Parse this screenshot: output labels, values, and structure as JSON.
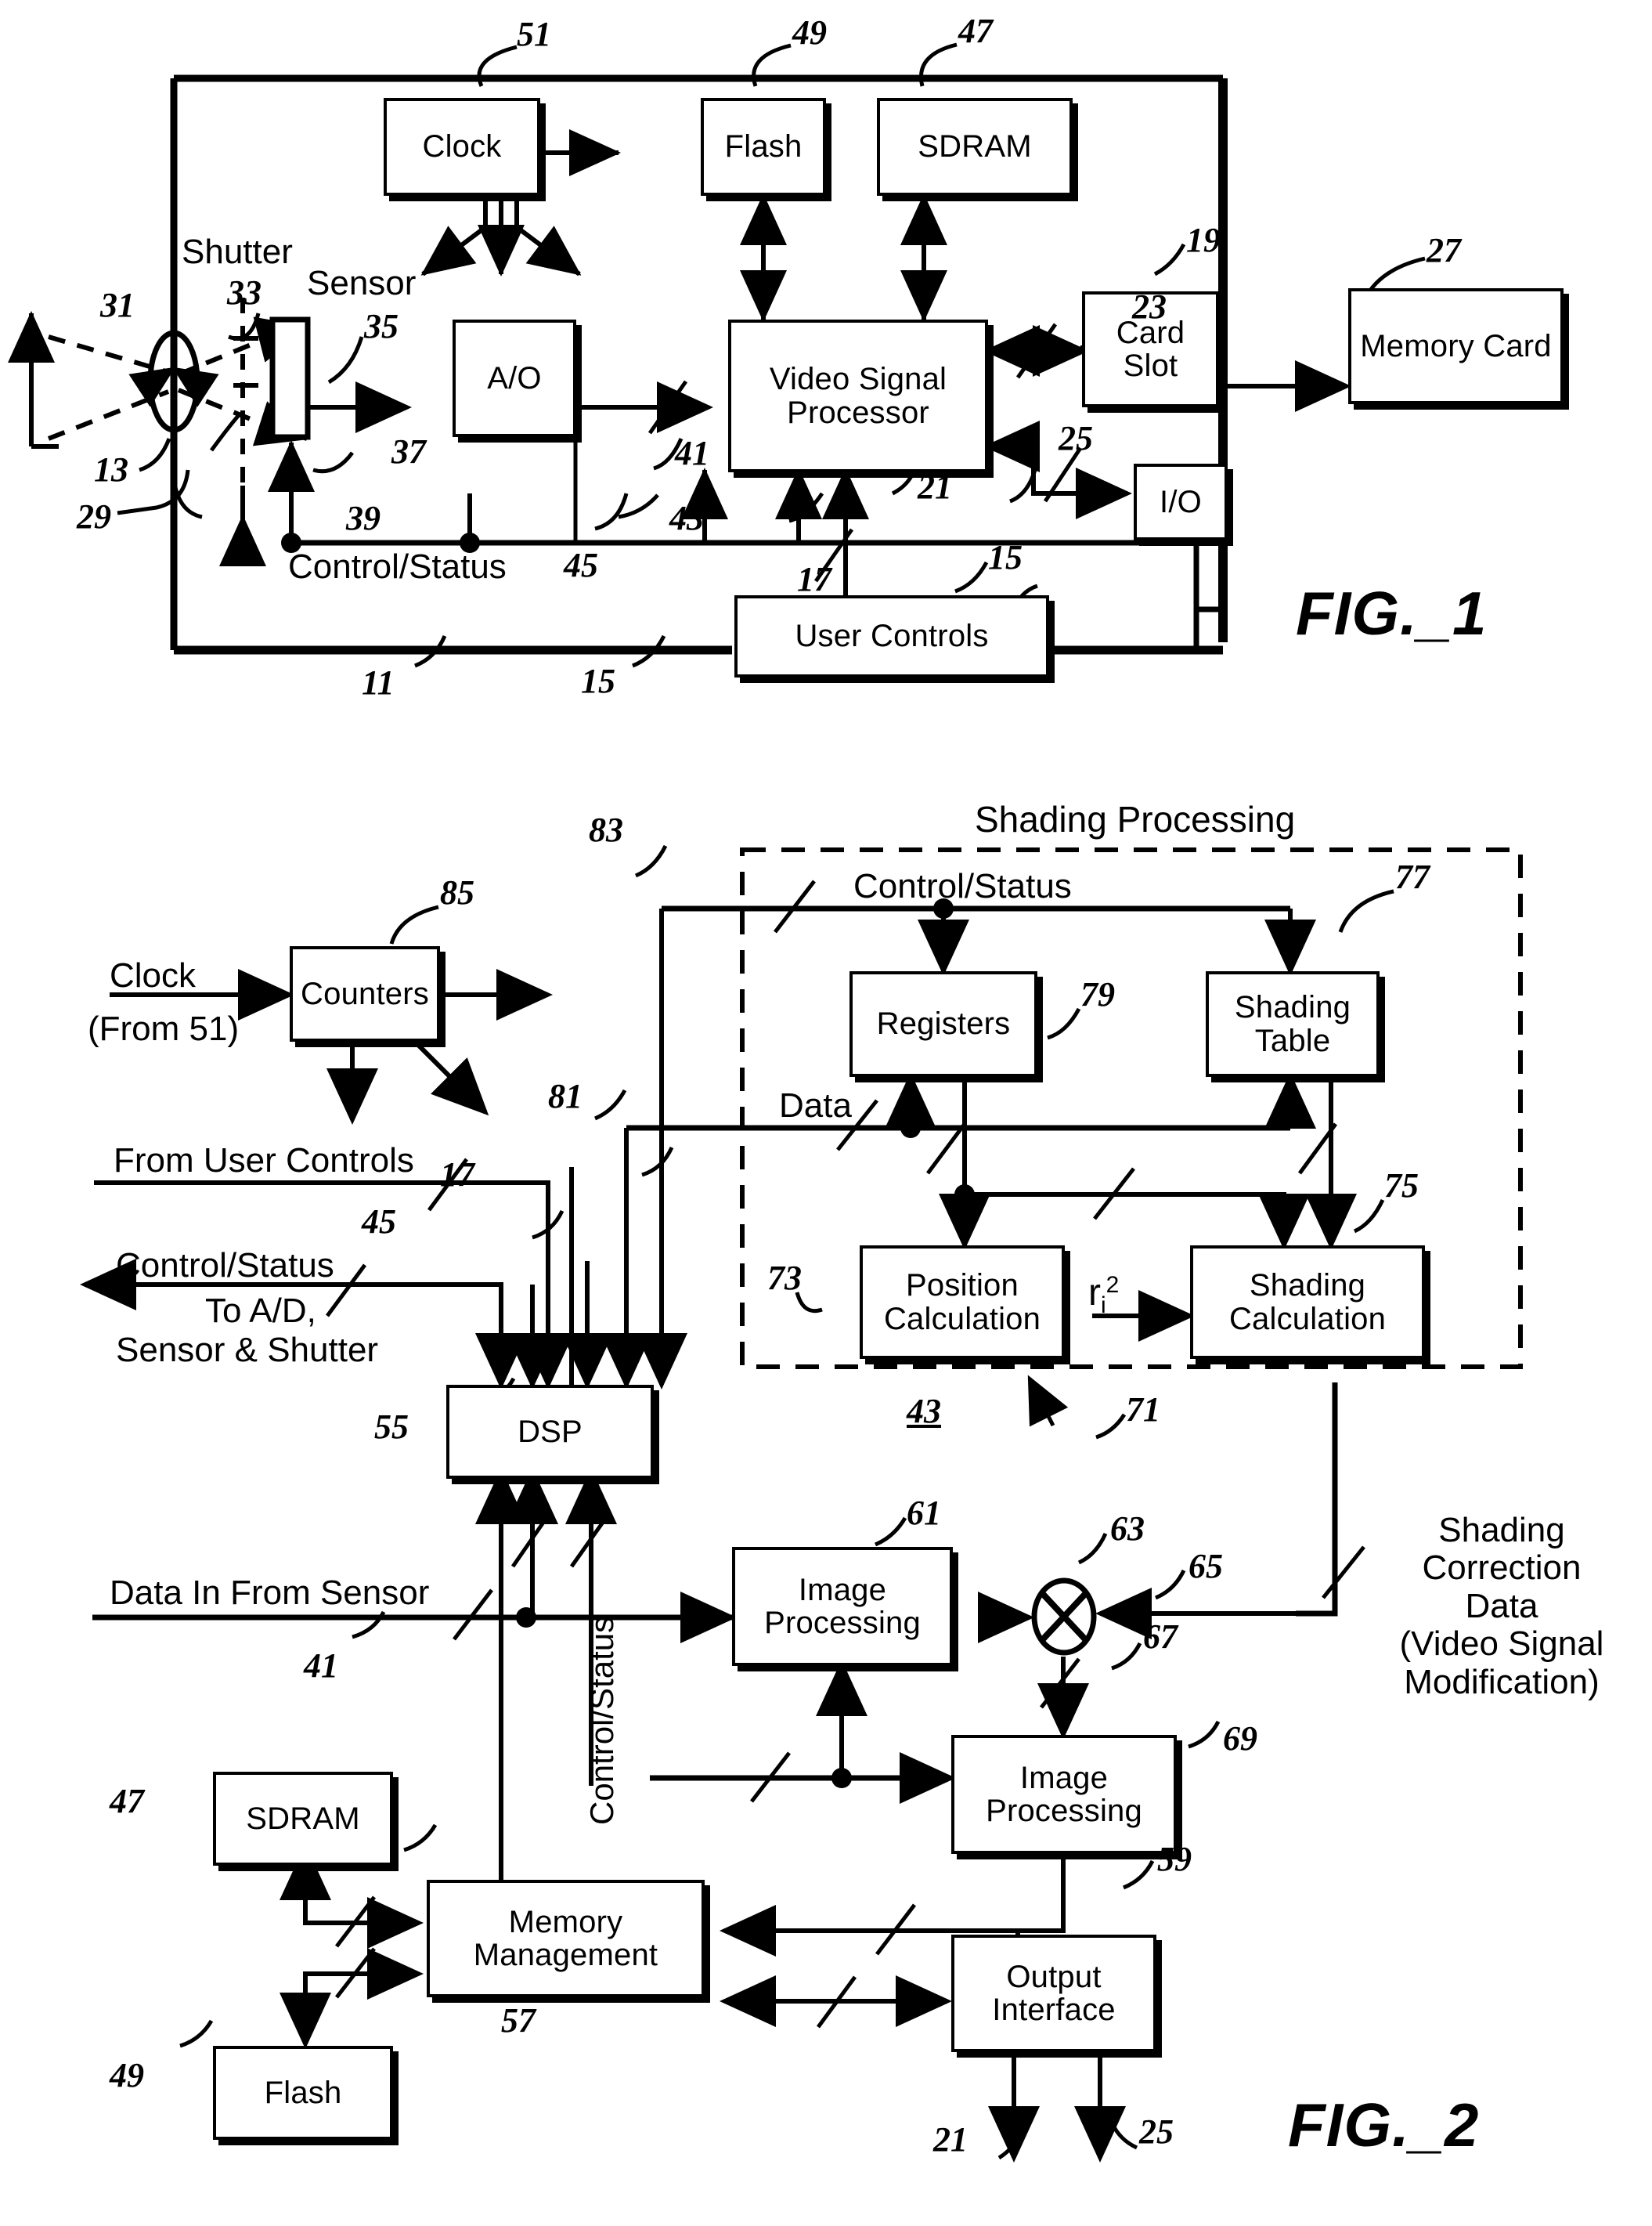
{
  "document": {
    "type": "patent-figure-sheet",
    "figures": [
      "FIG._1",
      "FIG._2"
    ]
  },
  "fig1": {
    "label": "FIG._1",
    "blocks": [
      {
        "id": "clock",
        "text": "Clock",
        "ref": "51"
      },
      {
        "id": "flash",
        "text": "Flash",
        "ref": "49"
      },
      {
        "id": "sdram",
        "text": "SDRAM",
        "ref": "47"
      },
      {
        "id": "ao",
        "text": "A/O",
        "ref": "39"
      },
      {
        "id": "vsp",
        "text": "Video Signal Processor",
        "ref": "43"
      },
      {
        "id": "cardslot",
        "text": "Card Slot",
        "ref": "23"
      },
      {
        "id": "memcard",
        "text": "Memory Card",
        "ref": "27"
      },
      {
        "id": "io",
        "text": "I/O",
        "ref": "19"
      },
      {
        "id": "usercon",
        "text": "User Controls",
        "ref": "15"
      }
    ],
    "text_labels": [
      {
        "id": "shutter",
        "text": "Shutter"
      },
      {
        "id": "sensor",
        "text": "Sensor"
      },
      {
        "id": "ctrlstat",
        "text": "Control/Status"
      }
    ],
    "refs": [
      "51",
      "49",
      "47",
      "31",
      "33",
      "35",
      "27",
      "23",
      "37",
      "41",
      "25",
      "19",
      "13",
      "29",
      "39",
      "43",
      "21",
      "45",
      "17",
      "15",
      "11",
      "15"
    ]
  },
  "fig2": {
    "label": "FIG._2",
    "group_title": "Shading Processing",
    "group_ref": "71",
    "group_underlined_ref": "43",
    "blocks": [
      {
        "id": "counters",
        "text": "Counters",
        "ref": "85"
      },
      {
        "id": "registers",
        "text": "Registers",
        "ref": "79"
      },
      {
        "id": "shadetable",
        "text": "Shading Table",
        "ref": "77"
      },
      {
        "id": "poscalc",
        "text": "Position Calculation",
        "ref": "73"
      },
      {
        "id": "shadecalc",
        "text": "Shading Calculation",
        "ref": "75"
      },
      {
        "id": "dsp",
        "text": "DSP",
        "ref": "55"
      },
      {
        "id": "imgproc1",
        "text": "Image Processing",
        "ref": "61"
      },
      {
        "id": "imgproc2",
        "text": "Image Processing",
        "ref": "69"
      },
      {
        "id": "sdram",
        "text": "SDRAM",
        "ref": "47"
      },
      {
        "id": "flash",
        "text": "Flash",
        "ref": "49"
      },
      {
        "id": "memmgmt",
        "text": "Memory Management",
        "ref": "57"
      },
      {
        "id": "outiface",
        "text": "Output Interface",
        "ref": "59"
      }
    ],
    "text_labels": [
      {
        "id": "clock-in",
        "text": "Clock"
      },
      {
        "id": "clock-in-source",
        "text": "(From 51)"
      },
      {
        "id": "ctrlstat-top",
        "text": "Control/Status"
      },
      {
        "id": "data",
        "text": "Data"
      },
      {
        "id": "from-user-ctrl",
        "text": "From User Controls"
      },
      {
        "id": "ctrlstat-out",
        "text": "Control/Status"
      },
      {
        "id": "to-ad-line1",
        "text": "To A/D,"
      },
      {
        "id": "to-ad-line2",
        "text": "Sensor & Shutter"
      },
      {
        "id": "data-in-sensor",
        "text": "Data In From Sensor"
      },
      {
        "id": "ctrlstat-vertical",
        "text": "Control/Status"
      },
      {
        "id": "ri2",
        "text": "r",
        "sub": "i",
        "sup": "2"
      },
      {
        "id": "shading-corr",
        "text": "Shading Correction Data (Video Signal Modification)"
      },
      {
        "id": "shading-corr-l1",
        "text": "Shading"
      },
      {
        "id": "shading-corr-l2",
        "text": "Correction"
      },
      {
        "id": "shading-corr-l3",
        "text": "Data"
      },
      {
        "id": "shading-corr-l4",
        "text": "(Video Signal"
      },
      {
        "id": "shading-corr-l5",
        "text": "Modification)"
      }
    ],
    "refs": [
      "85",
      "83",
      "81",
      "77",
      "79",
      "17",
      "45",
      "73",
      "75",
      "71",
      "43",
      "55",
      "61",
      "63",
      "65",
      "67",
      "69",
      "41",
      "47",
      "49",
      "57",
      "59",
      "21",
      "25"
    ]
  },
  "colors": {
    "ink": "#000000",
    "paper": "#ffffff"
  }
}
